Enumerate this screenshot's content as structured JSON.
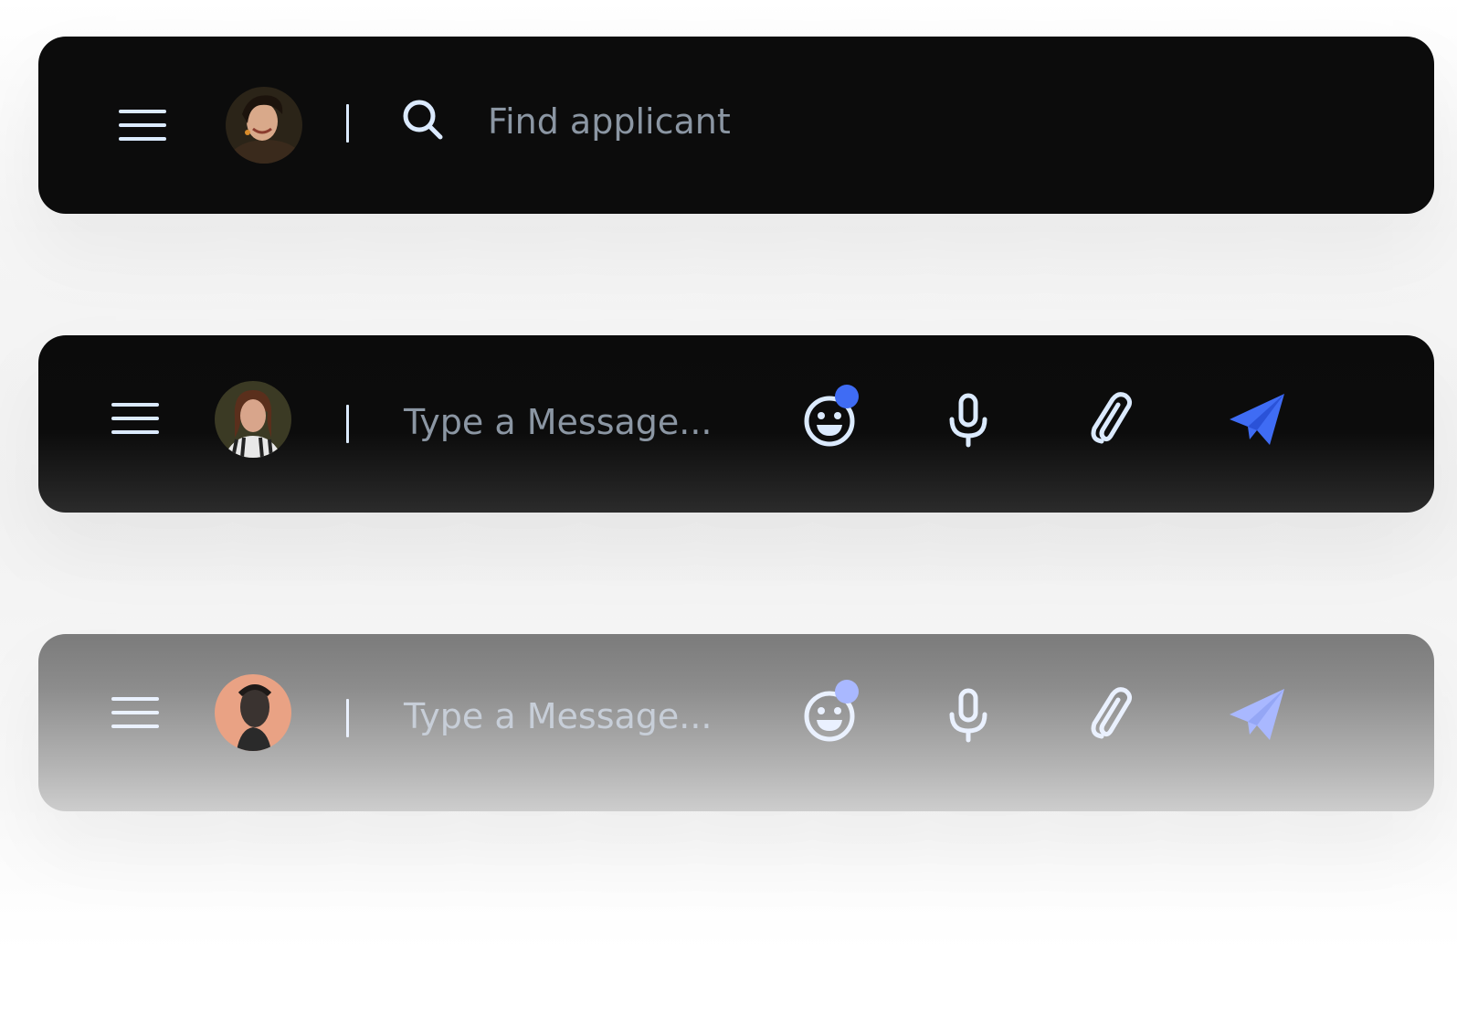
{
  "colors": {
    "icon_light": "#dbeafe",
    "placeholder": "#8b96a3",
    "accent_blue": "#3f6cf4",
    "accent_blue_disabled": "#a9b8ff",
    "bar_dark": "#0c0c0c"
  },
  "search_bar": {
    "menu_icon": "hamburger-menu-icon",
    "avatar": "avatar-woman-smiling",
    "search_icon": "search-icon",
    "placeholder": "Find applicant"
  },
  "message_bar": {
    "menu_icon": "hamburger-menu-icon",
    "avatar": "avatar-woman-striped-shirt",
    "placeholder": "Type a Message...",
    "emoji_icon": "smiley-emoji-icon",
    "mic_icon": "microphone-icon",
    "attach_icon": "paperclip-icon",
    "send_icon": "paper-plane-send-icon"
  },
  "message_bar_disabled": {
    "menu_icon": "hamburger-menu-icon",
    "avatar": "avatar-man-portrait",
    "placeholder": "Type a Message...",
    "emoji_icon": "smiley-emoji-icon",
    "mic_icon": "microphone-icon",
    "attach_icon": "paperclip-icon",
    "send_icon": "paper-plane-send-icon"
  }
}
